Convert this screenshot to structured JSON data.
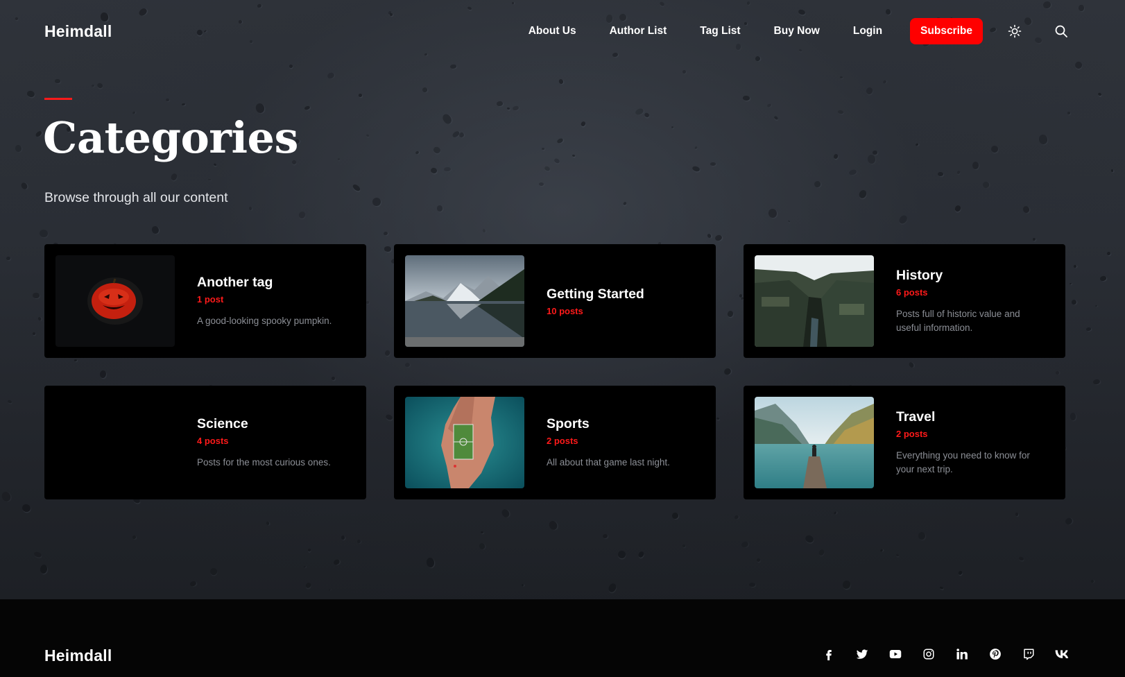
{
  "site": {
    "logo": "Heimdall"
  },
  "nav": {
    "items": [
      "About Us",
      "Author List",
      "Tag List",
      "Buy Now",
      "Login"
    ],
    "subscribe": "Subscribe",
    "theme_icon": "sun-icon",
    "search_icon": "search-icon"
  },
  "page": {
    "title": "Categories",
    "subtitle": "Browse through all our content"
  },
  "categories": [
    {
      "title": "Another tag",
      "count": "1 post",
      "description": "A good-looking spooky pumpkin.",
      "image": "pumpkin"
    },
    {
      "title": "Getting Started",
      "count": "10 posts",
      "description": "",
      "image": "mountain-lake"
    },
    {
      "title": "History",
      "count": "6 posts",
      "description": "Posts full of historic value and useful information.",
      "image": "canyon"
    },
    {
      "title": "Science",
      "count": "4 posts",
      "description": "Posts for the most curious ones.",
      "image": "none"
    },
    {
      "title": "Sports",
      "count": "2 posts",
      "description": "All about that game last night.",
      "image": "island-field"
    },
    {
      "title": "Travel",
      "count": "2 posts",
      "description": "Everything you need to know for your next trip.",
      "image": "lake-pier"
    }
  ],
  "footer": {
    "logo": "Heimdall",
    "socials": [
      "facebook-icon",
      "twitter-icon",
      "youtube-icon",
      "instagram-icon",
      "linkedin-icon",
      "pinterest-icon",
      "twitch-icon",
      "vk-icon"
    ]
  },
  "colors": {
    "accent": "#ff0000",
    "card_bg": "#000000",
    "muted_text": "#8c8f96"
  }
}
